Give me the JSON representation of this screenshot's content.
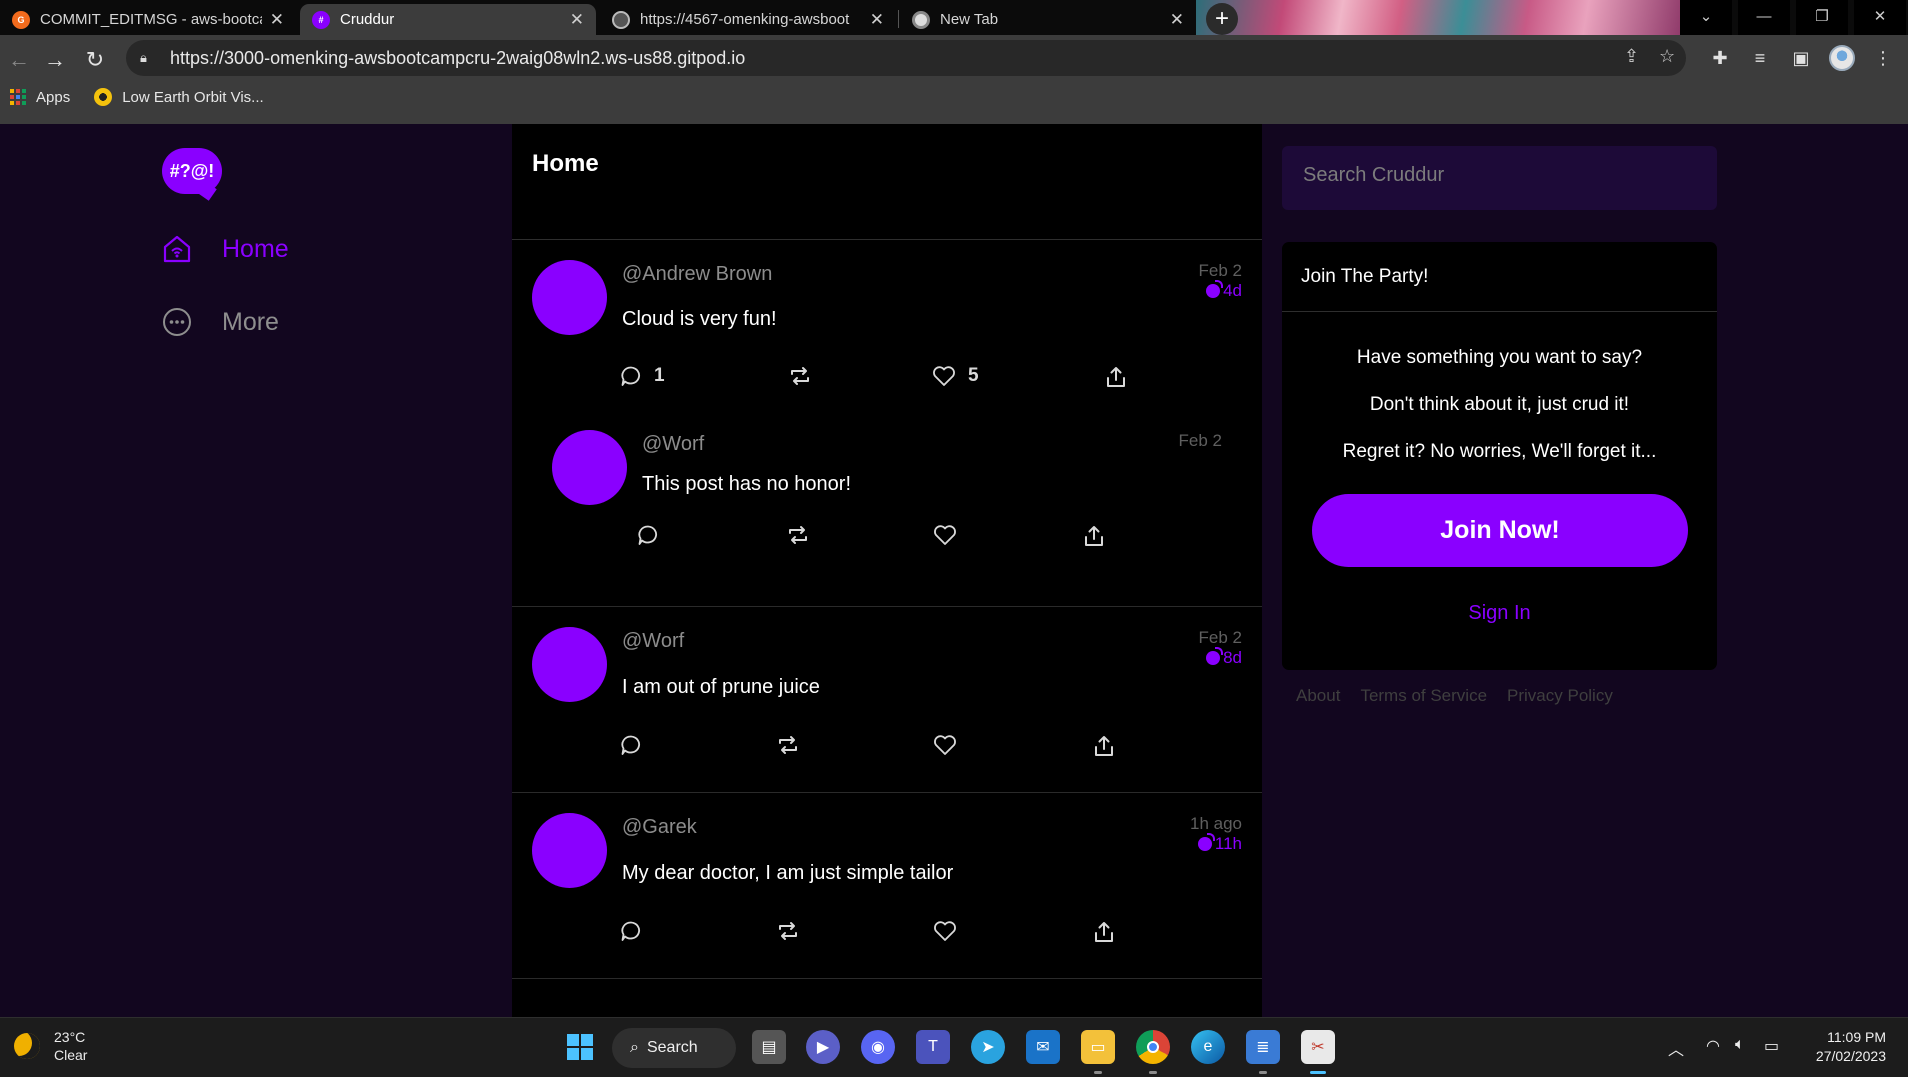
{
  "browser": {
    "tabs": [
      {
        "title": "COMMIT_EDITMSG - aws-bootca",
        "close": "✕"
      },
      {
        "title": "Cruddur",
        "close": "✕"
      },
      {
        "title": "https://4567-omenking-awsboot",
        "close": "✕"
      },
      {
        "title": "New Tab",
        "close": "✕"
      }
    ],
    "new_tab": "+",
    "url": "https://3000-omenking-awsbootcampcru-2waig08wln2.ws-us88.gitpod.io",
    "bookmarks": [
      {
        "label": "Apps"
      },
      {
        "label": "Low Earth Orbit Vis..."
      }
    ]
  },
  "app": {
    "logo_text": "#?@!",
    "nav": [
      {
        "label": "Home"
      },
      {
        "label": "More"
      }
    ],
    "feed_title": "Home",
    "activities": [
      {
        "handle": "@Andrew Brown",
        "message": "Cloud is very fun!",
        "created": "Feb 2",
        "expires": "4d",
        "replies": "1",
        "likes": "5"
      },
      {
        "handle": "@Worf",
        "message": "This post has no honor!",
        "created": "Feb 2"
      },
      {
        "handle": "@Worf",
        "message": "I am out of prune juice",
        "created": "Feb 2",
        "expires": "8d"
      },
      {
        "handle": "@Garek",
        "message": "My dear doctor, I am just simple tailor",
        "created": "1h ago",
        "expires": "11h"
      }
    ],
    "search_placeholder": "Search Cruddur",
    "join": {
      "title": "Join The Party!",
      "lines": [
        "Have something you want to say?",
        "Don't think about it, just crud it!",
        "Regret it? No worries, We'll forget it..."
      ],
      "button": "Join Now!",
      "sign_in": "Sign In"
    },
    "footer": [
      "About",
      "Terms of Service",
      "Privacy Policy"
    ],
    "accent_color": "#8a00ff"
  },
  "taskbar": {
    "temperature": "23°C",
    "condition": "Clear",
    "search_label": "Search",
    "time": "11:09 PM",
    "date": "27/02/2023"
  }
}
